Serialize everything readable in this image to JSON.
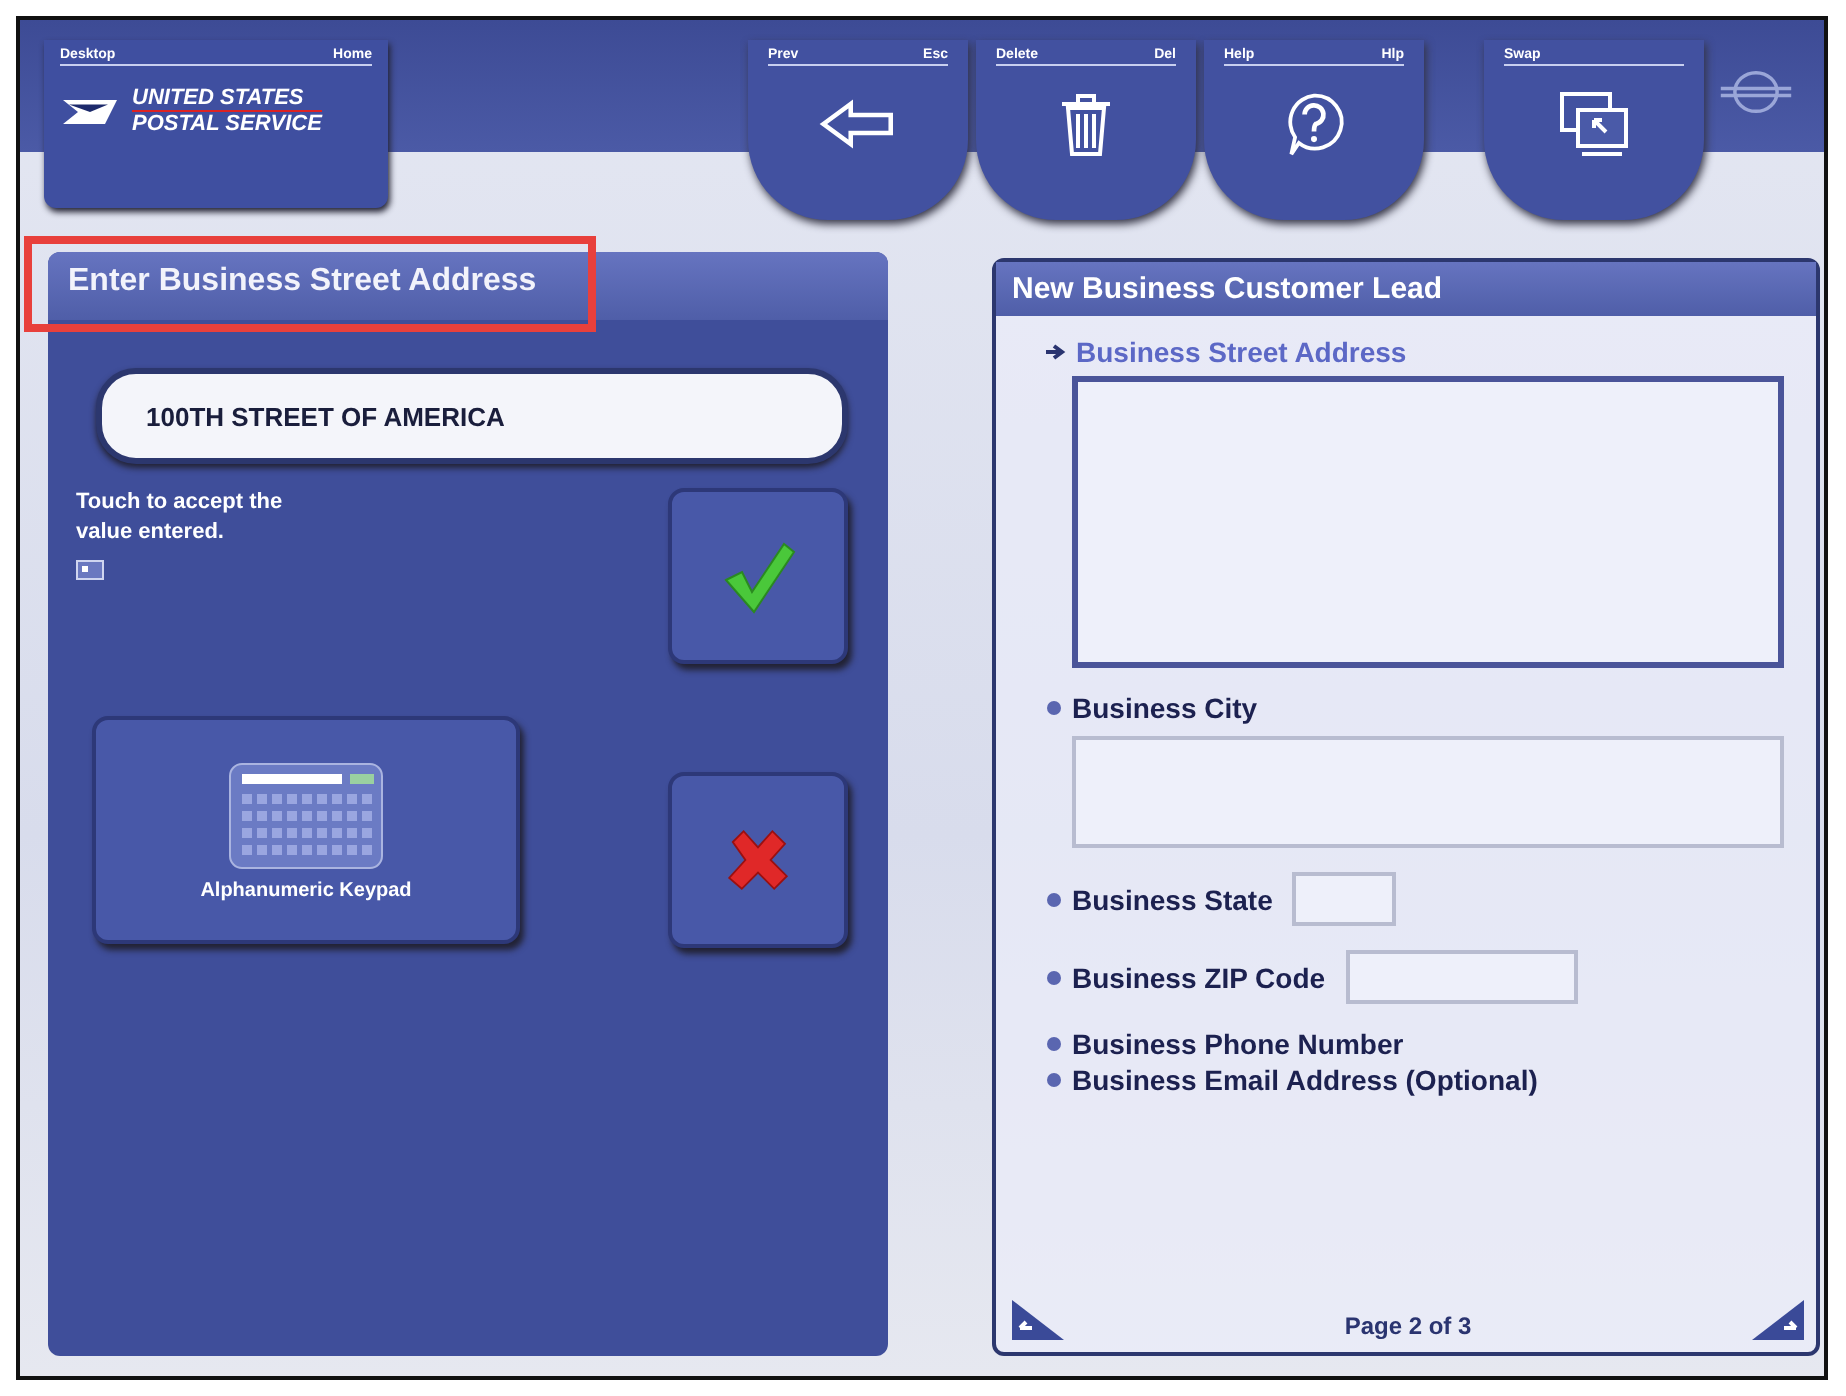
{
  "logo_tab": {
    "left_label": "Desktop",
    "right_label": "Home",
    "line1": "UNITED STATES",
    "line2": "POSTAL SERVICE"
  },
  "toolbar": [
    {
      "kind": "back",
      "label": "Prev",
      "shortcut": "Esc"
    },
    {
      "kind": "trash",
      "label": "Delete",
      "shortcut": "Del"
    },
    {
      "kind": "help",
      "label": "Help",
      "shortcut": "Hlp"
    },
    {
      "kind": "swap",
      "label": "Swap"
    }
  ],
  "entry_panel": {
    "title": "Enter Business Street Address",
    "highlighted": true,
    "value": "100TH STREET OF AMERICA",
    "hint": "Touch to accept the value entered.",
    "keypad_label": "Alphanumeric Keypad"
  },
  "lead_panel": {
    "title": "New Business Customer Lead",
    "fields": [
      {
        "label": "Business Street Address",
        "kind": "area",
        "selected": true
      },
      {
        "label": "Business City",
        "kind": "wide",
        "selected": false
      },
      {
        "label": "Business State",
        "kind": "short",
        "selected": false
      },
      {
        "label": "Business ZIP Code",
        "kind": "medium",
        "selected": false
      },
      {
        "label": "Business Phone Number",
        "kind": "none",
        "selected": false
      },
      {
        "label": "Business Email Address (Optional)",
        "kind": "none",
        "selected": false
      }
    ],
    "page": "Page 2 of 3"
  }
}
